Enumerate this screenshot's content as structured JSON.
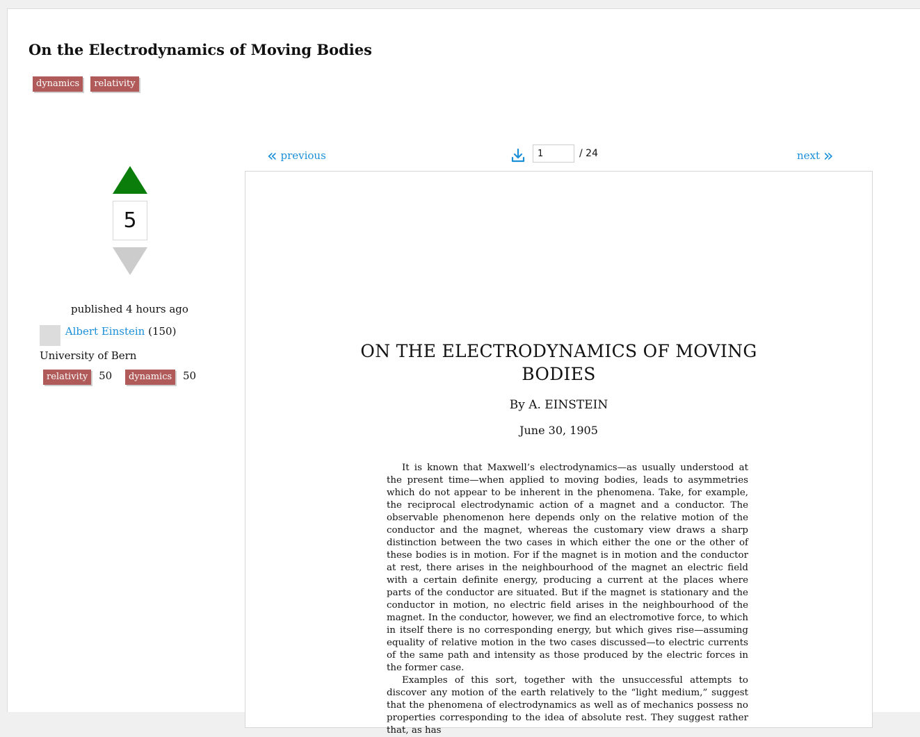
{
  "page_title": "On the Electrodynamics of Moving Bodies",
  "tags": [
    "dynamics",
    "relativity"
  ],
  "vote": {
    "count": "5"
  },
  "meta": {
    "published": "published 4 hours ago",
    "author_name": "Albert Einstein",
    "author_rep": "(150)",
    "affiliation": "University of Bern",
    "reputation": [
      {
        "tag": "relativity",
        "score": "50"
      },
      {
        "tag": "dynamics",
        "score": "50"
      }
    ]
  },
  "viewer": {
    "previous_label": "previous",
    "next_label": "next",
    "page_value": "1",
    "page_total": "/ 24"
  },
  "document": {
    "title_line1": "ON THE ELECTRODYNAMICS OF MOVING",
    "title_line2": "BODIES",
    "author": "By A. EINSTEIN",
    "date": "June 30, 1905",
    "para1": "It is known that Maxwell’s electrodynamics—as usually understood at the present time—when applied to moving bodies, leads to asymmetries which do not appear to be inherent in the phenomena. Take, for example, the reciprocal electrodynamic action of a magnet and a conductor. The observable phenomenon here depends only on the relative motion of the conductor and the magnet, whereas the customary view draws a sharp distinction between the two cases in which either the one or the other of these bodies is in motion. For if the magnet is in motion and the conductor at rest, there arises in the neighbourhood of the magnet an electric field with a certain definite energy, producing a current at the places where parts of the conductor are situated. But if the magnet is stationary and the conductor in motion, no electric field arises in the neighbourhood of the magnet. In the conductor, however, we find an electromotive force, to which in itself there is no corresponding energy, but which gives rise—assuming equality of relative motion in the two cases discussed—to electric currents of the same path and intensity as those produced by the electric forces in the former case.",
    "para2": "Examples of this sort, together with the unsuccessful attempts to discover any motion of the earth relatively to the “light medium,” suggest that the phenomena of electrodynamics as well as of mechanics possess no properties corresponding to the idea of absolute rest. They suggest rather that, as has"
  },
  "colors": {
    "tag_bg": "#b05a5a",
    "link": "#1a8fd8",
    "upvote": "#0a7d0a",
    "downvote": "#cccccc"
  },
  "icons": [
    "chevrons-left-icon",
    "chevrons-right-icon",
    "download-icon",
    "upvote-arrow-icon",
    "downvote-arrow-icon"
  ]
}
